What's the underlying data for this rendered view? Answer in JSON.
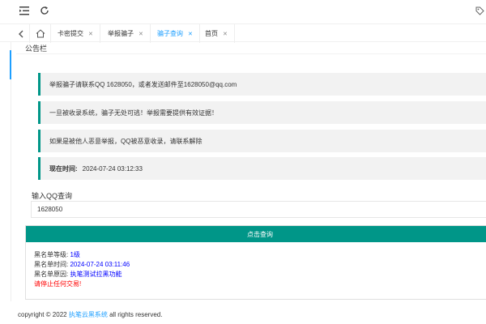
{
  "toolbar": {
    "menu_icon": "menu-fold-icon",
    "refresh_icon": "refresh-icon",
    "tag_icon": "tag-icon"
  },
  "tabs": [
    {
      "label": "卡密提交",
      "active": false
    },
    {
      "label": "举报骗子",
      "active": false
    },
    {
      "label": "骗子查询",
      "active": true
    },
    {
      "label": "首页",
      "active": false
    }
  ],
  "card": {
    "title": "公告栏"
  },
  "notices": [
    "举报骗子请联系QQ 1628050，或者发送邮件至1628050@qq.com",
    "一旦被收录系统，骗子无处可逃！举报需要提供有效证据！",
    "如果是被他人恶意举报，QQ被恶意收录，请联系解除"
  ],
  "time_notice": {
    "label": "现在时间:",
    "value": "2024-07-24 03:12:33"
  },
  "query": {
    "label": "输入QQ查询",
    "value": "1628050",
    "button": "点击查询"
  },
  "result": {
    "level_label": "黑名单等级:",
    "level_value": "1级",
    "time_label": "黑名单时间:",
    "time_value": "2024-07-24 03:11:46",
    "reason_label": "黑名单原因:",
    "reason_value": "执笔测试拉黑功能",
    "warning": "请停止任何交易!"
  },
  "footer": {
    "prefix": "copyright © 2022",
    "link": "执笔云黑系统",
    "suffix": "all rights reserved."
  },
  "colors": {
    "accent": "#009688",
    "active_tab": "#1e9fff",
    "value_text": "#0000ff",
    "warning_text": "#ff0000"
  }
}
